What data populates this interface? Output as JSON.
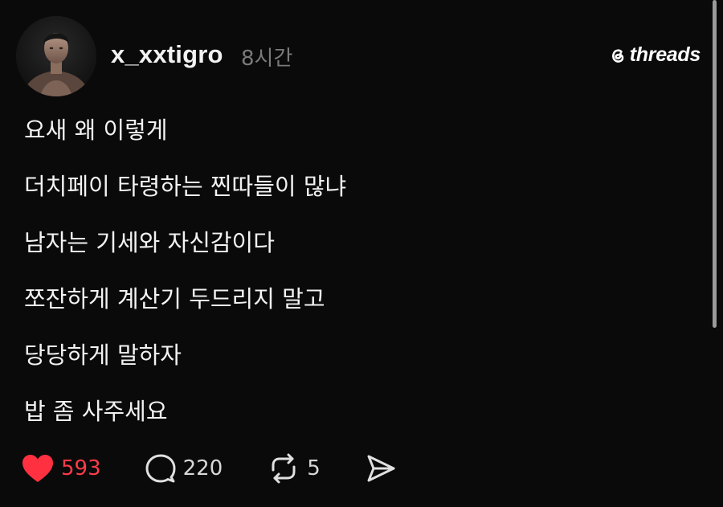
{
  "post": {
    "username": "x_xxtigro",
    "time": "8시간",
    "brand": "threads",
    "lines": [
      "요새 왜 이렇게",
      "더치페이 타령하는 찐따들이 많냐",
      "남자는 기세와 자신감이다",
      "쪼잔하게 계산기 두드리지 말고",
      "당당하게 말하자",
      "밥 좀 사주세요"
    ],
    "actions": {
      "likes": "593",
      "comments": "220",
      "reposts": "5"
    }
  },
  "colors": {
    "background": "#0a0a0a",
    "text": "#f3f3f3",
    "muted": "#7a7a7a",
    "like": "#ff3b4a"
  },
  "icons": [
    "threads-logo-icon",
    "heart-icon",
    "comment-icon",
    "repost-icon",
    "share-icon"
  ]
}
